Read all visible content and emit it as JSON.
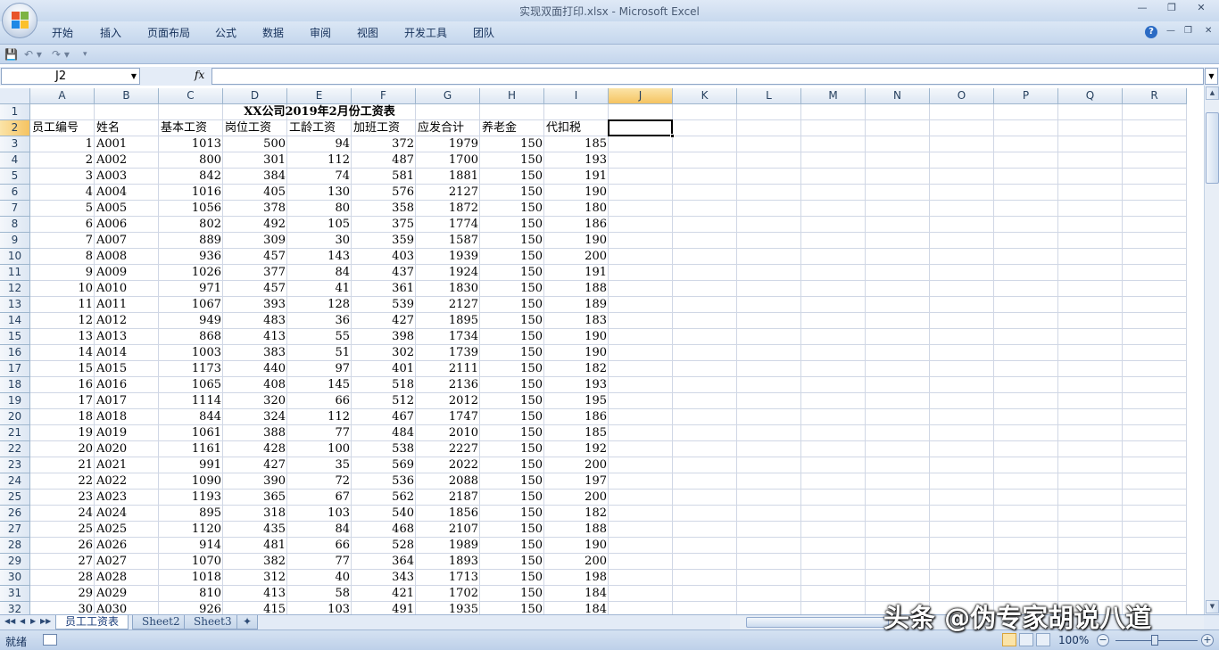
{
  "window": {
    "title": "实现双面打印.xlsx - Microsoft Excel"
  },
  "ribbon": {
    "tabs": [
      "开始",
      "插入",
      "页面布局",
      "公式",
      "数据",
      "审阅",
      "视图",
      "开发工具",
      "团队"
    ]
  },
  "formula_bar": {
    "name_box": "J2",
    "fx_label": "fx",
    "content": ""
  },
  "grid": {
    "columns": [
      "A",
      "B",
      "C",
      "D",
      "E",
      "F",
      "G",
      "H",
      "I",
      "J",
      "K",
      "L",
      "M",
      "N",
      "O",
      "P",
      "Q",
      "R"
    ],
    "selected_column": "J",
    "selected_row": 2,
    "title_row": "XX公司2019年2月份工资表",
    "headers": [
      "员工编号",
      "姓名",
      "基本工资",
      "岗位工资",
      "工龄工资",
      "加班工资",
      "应发合计",
      "养老金",
      "代扣税"
    ],
    "rows": [
      [
        1,
        "A001",
        1013,
        500,
        94,
        372,
        1979,
        150,
        185
      ],
      [
        2,
        "A002",
        800,
        301,
        112,
        487,
        1700,
        150,
        193
      ],
      [
        3,
        "A003",
        842,
        384,
        74,
        581,
        1881,
        150,
        191
      ],
      [
        4,
        "A004",
        1016,
        405,
        130,
        576,
        2127,
        150,
        190
      ],
      [
        5,
        "A005",
        1056,
        378,
        80,
        358,
        1872,
        150,
        180
      ],
      [
        6,
        "A006",
        802,
        492,
        105,
        375,
        1774,
        150,
        186
      ],
      [
        7,
        "A007",
        889,
        309,
        30,
        359,
        1587,
        150,
        190
      ],
      [
        8,
        "A008",
        936,
        457,
        143,
        403,
        1939,
        150,
        200
      ],
      [
        9,
        "A009",
        1026,
        377,
        84,
        437,
        1924,
        150,
        191
      ],
      [
        10,
        "A010",
        971,
        457,
        41,
        361,
        1830,
        150,
        188
      ],
      [
        11,
        "A011",
        1067,
        393,
        128,
        539,
        2127,
        150,
        189
      ],
      [
        12,
        "A012",
        949,
        483,
        36,
        427,
        1895,
        150,
        183
      ],
      [
        13,
        "A013",
        868,
        413,
        55,
        398,
        1734,
        150,
        190
      ],
      [
        14,
        "A014",
        1003,
        383,
        51,
        302,
        1739,
        150,
        190
      ],
      [
        15,
        "A015",
        1173,
        440,
        97,
        401,
        2111,
        150,
        182
      ],
      [
        16,
        "A016",
        1065,
        408,
        145,
        518,
        2136,
        150,
        193
      ],
      [
        17,
        "A017",
        1114,
        320,
        66,
        512,
        2012,
        150,
        195
      ],
      [
        18,
        "A018",
        844,
        324,
        112,
        467,
        1747,
        150,
        186
      ],
      [
        19,
        "A019",
        1061,
        388,
        77,
        484,
        2010,
        150,
        185
      ],
      [
        20,
        "A020",
        1161,
        428,
        100,
        538,
        2227,
        150,
        192
      ],
      [
        21,
        "A021",
        991,
        427,
        35,
        569,
        2022,
        150,
        200
      ],
      [
        22,
        "A022",
        1090,
        390,
        72,
        536,
        2088,
        150,
        197
      ],
      [
        23,
        "A023",
        1193,
        365,
        67,
        562,
        2187,
        150,
        200
      ],
      [
        24,
        "A024",
        895,
        318,
        103,
        540,
        1856,
        150,
        182
      ],
      [
        25,
        "A025",
        1120,
        435,
        84,
        468,
        2107,
        150,
        188
      ],
      [
        26,
        "A026",
        914,
        481,
        66,
        528,
        1989,
        150,
        190
      ],
      [
        27,
        "A027",
        1070,
        382,
        77,
        364,
        1893,
        150,
        200
      ],
      [
        28,
        "A028",
        1018,
        312,
        40,
        343,
        1713,
        150,
        198
      ],
      [
        29,
        "A029",
        810,
        413,
        58,
        421,
        1702,
        150,
        184
      ],
      [
        30,
        "A030",
        926,
        415,
        103,
        491,
        1935,
        150,
        184
      ]
    ]
  },
  "sheets": {
    "tabs": [
      "员工工资表",
      "Sheet2",
      "Sheet3"
    ],
    "active": "员工工资表"
  },
  "status": {
    "ready_text": "就绪",
    "zoom": "100%"
  },
  "watermark": "头条 @伪专家胡说八道"
}
